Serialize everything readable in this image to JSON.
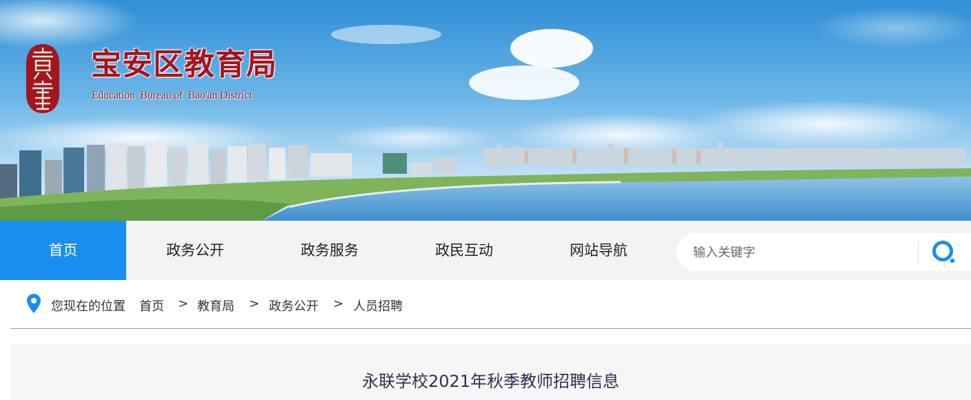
{
  "header": {
    "logo_cn": "宝安区教育局",
    "logo_en": "Education  Bureau of  Bao'an District"
  },
  "nav": {
    "items": [
      {
        "label": "首页",
        "active": true
      },
      {
        "label": "政务公开"
      },
      {
        "label": "政务服务"
      },
      {
        "label": "政民互动"
      },
      {
        "label": "网站导航"
      }
    ],
    "search_placeholder": "输入关键字"
  },
  "breadcrumb": {
    "prefix": "您现在的位置",
    "items": [
      "首页",
      "教育局",
      "政务公开",
      "人员招聘"
    ],
    "separator": ">"
  },
  "article": {
    "title": "永联学校2021年秋季教师招聘信息"
  },
  "colors": {
    "accent": "#1a8ef0",
    "logo_red": "#a5151e"
  },
  "icons": [
    "location-pin-icon",
    "search-icon",
    "seal-logo-icon"
  ]
}
